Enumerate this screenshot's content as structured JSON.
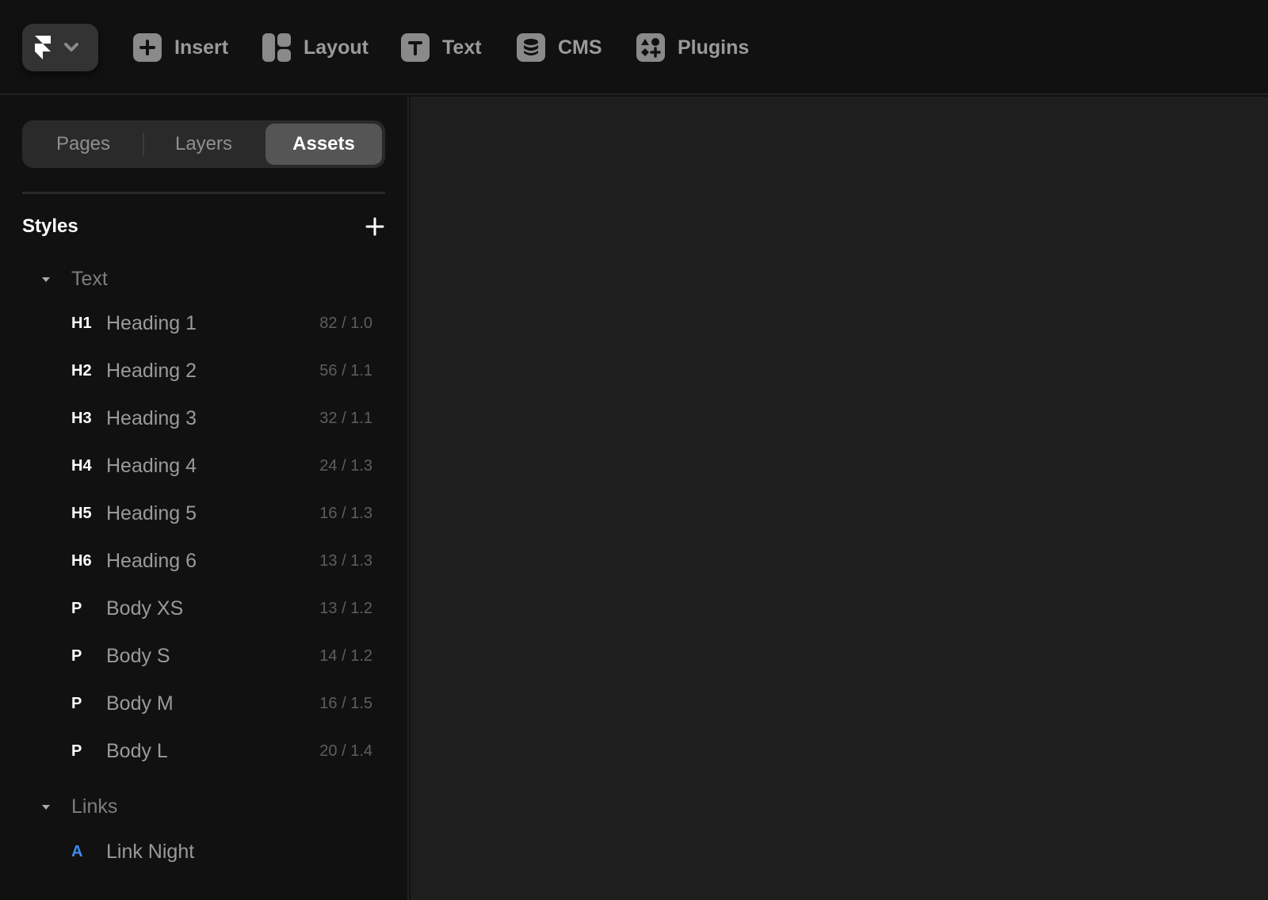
{
  "toolbar": {
    "logo": "framer-logo-icon",
    "menu_chevron": "chevron-down-icon",
    "tools": [
      {
        "label": "Insert",
        "icon": "plus-square-icon"
      },
      {
        "label": "Layout",
        "icon": "layout-icon"
      },
      {
        "label": "Text",
        "icon": "text-T-icon"
      },
      {
        "label": "CMS",
        "icon": "database-icon"
      },
      {
        "label": "Plugins",
        "icon": "shapes-icon"
      }
    ]
  },
  "sidebar": {
    "tabs": [
      {
        "label": "Pages",
        "active": false
      },
      {
        "label": "Layers",
        "active": false
      },
      {
        "label": "Assets",
        "active": true
      }
    ],
    "section_title": "Styles",
    "add_icon": "plus-icon",
    "groups": [
      {
        "label": "Text",
        "expanded": true,
        "items": [
          {
            "tag": "H1",
            "name": "Heading 1",
            "meta": "82 / 1.0"
          },
          {
            "tag": "H2",
            "name": "Heading 2",
            "meta": "56 / 1.1"
          },
          {
            "tag": "H3",
            "name": "Heading 3",
            "meta": "32 / 1.1"
          },
          {
            "tag": "H4",
            "name": "Heading 4",
            "meta": "24 / 1.3"
          },
          {
            "tag": "H5",
            "name": "Heading 5",
            "meta": "16 / 1.3"
          },
          {
            "tag": "H6",
            "name": "Heading 6",
            "meta": "13 / 1.3"
          },
          {
            "tag": "P",
            "name": "Body XS",
            "meta": "13 / 1.2"
          },
          {
            "tag": "P",
            "name": "Body S",
            "meta": "14 / 1.2"
          },
          {
            "tag": "P",
            "name": "Body M",
            "meta": "16 / 1.5"
          },
          {
            "tag": "P",
            "name": "Body L",
            "meta": "20 / 1.4"
          }
        ]
      },
      {
        "label": "Links",
        "expanded": true,
        "items": [
          {
            "tag": "A",
            "name": "Link Night",
            "meta": ""
          }
        ]
      }
    ]
  },
  "colors": {
    "background": "#111111",
    "canvas": "#1e1e1e",
    "link_accent": "#3d8bf0",
    "icon_fill": "#8a8a8a"
  }
}
